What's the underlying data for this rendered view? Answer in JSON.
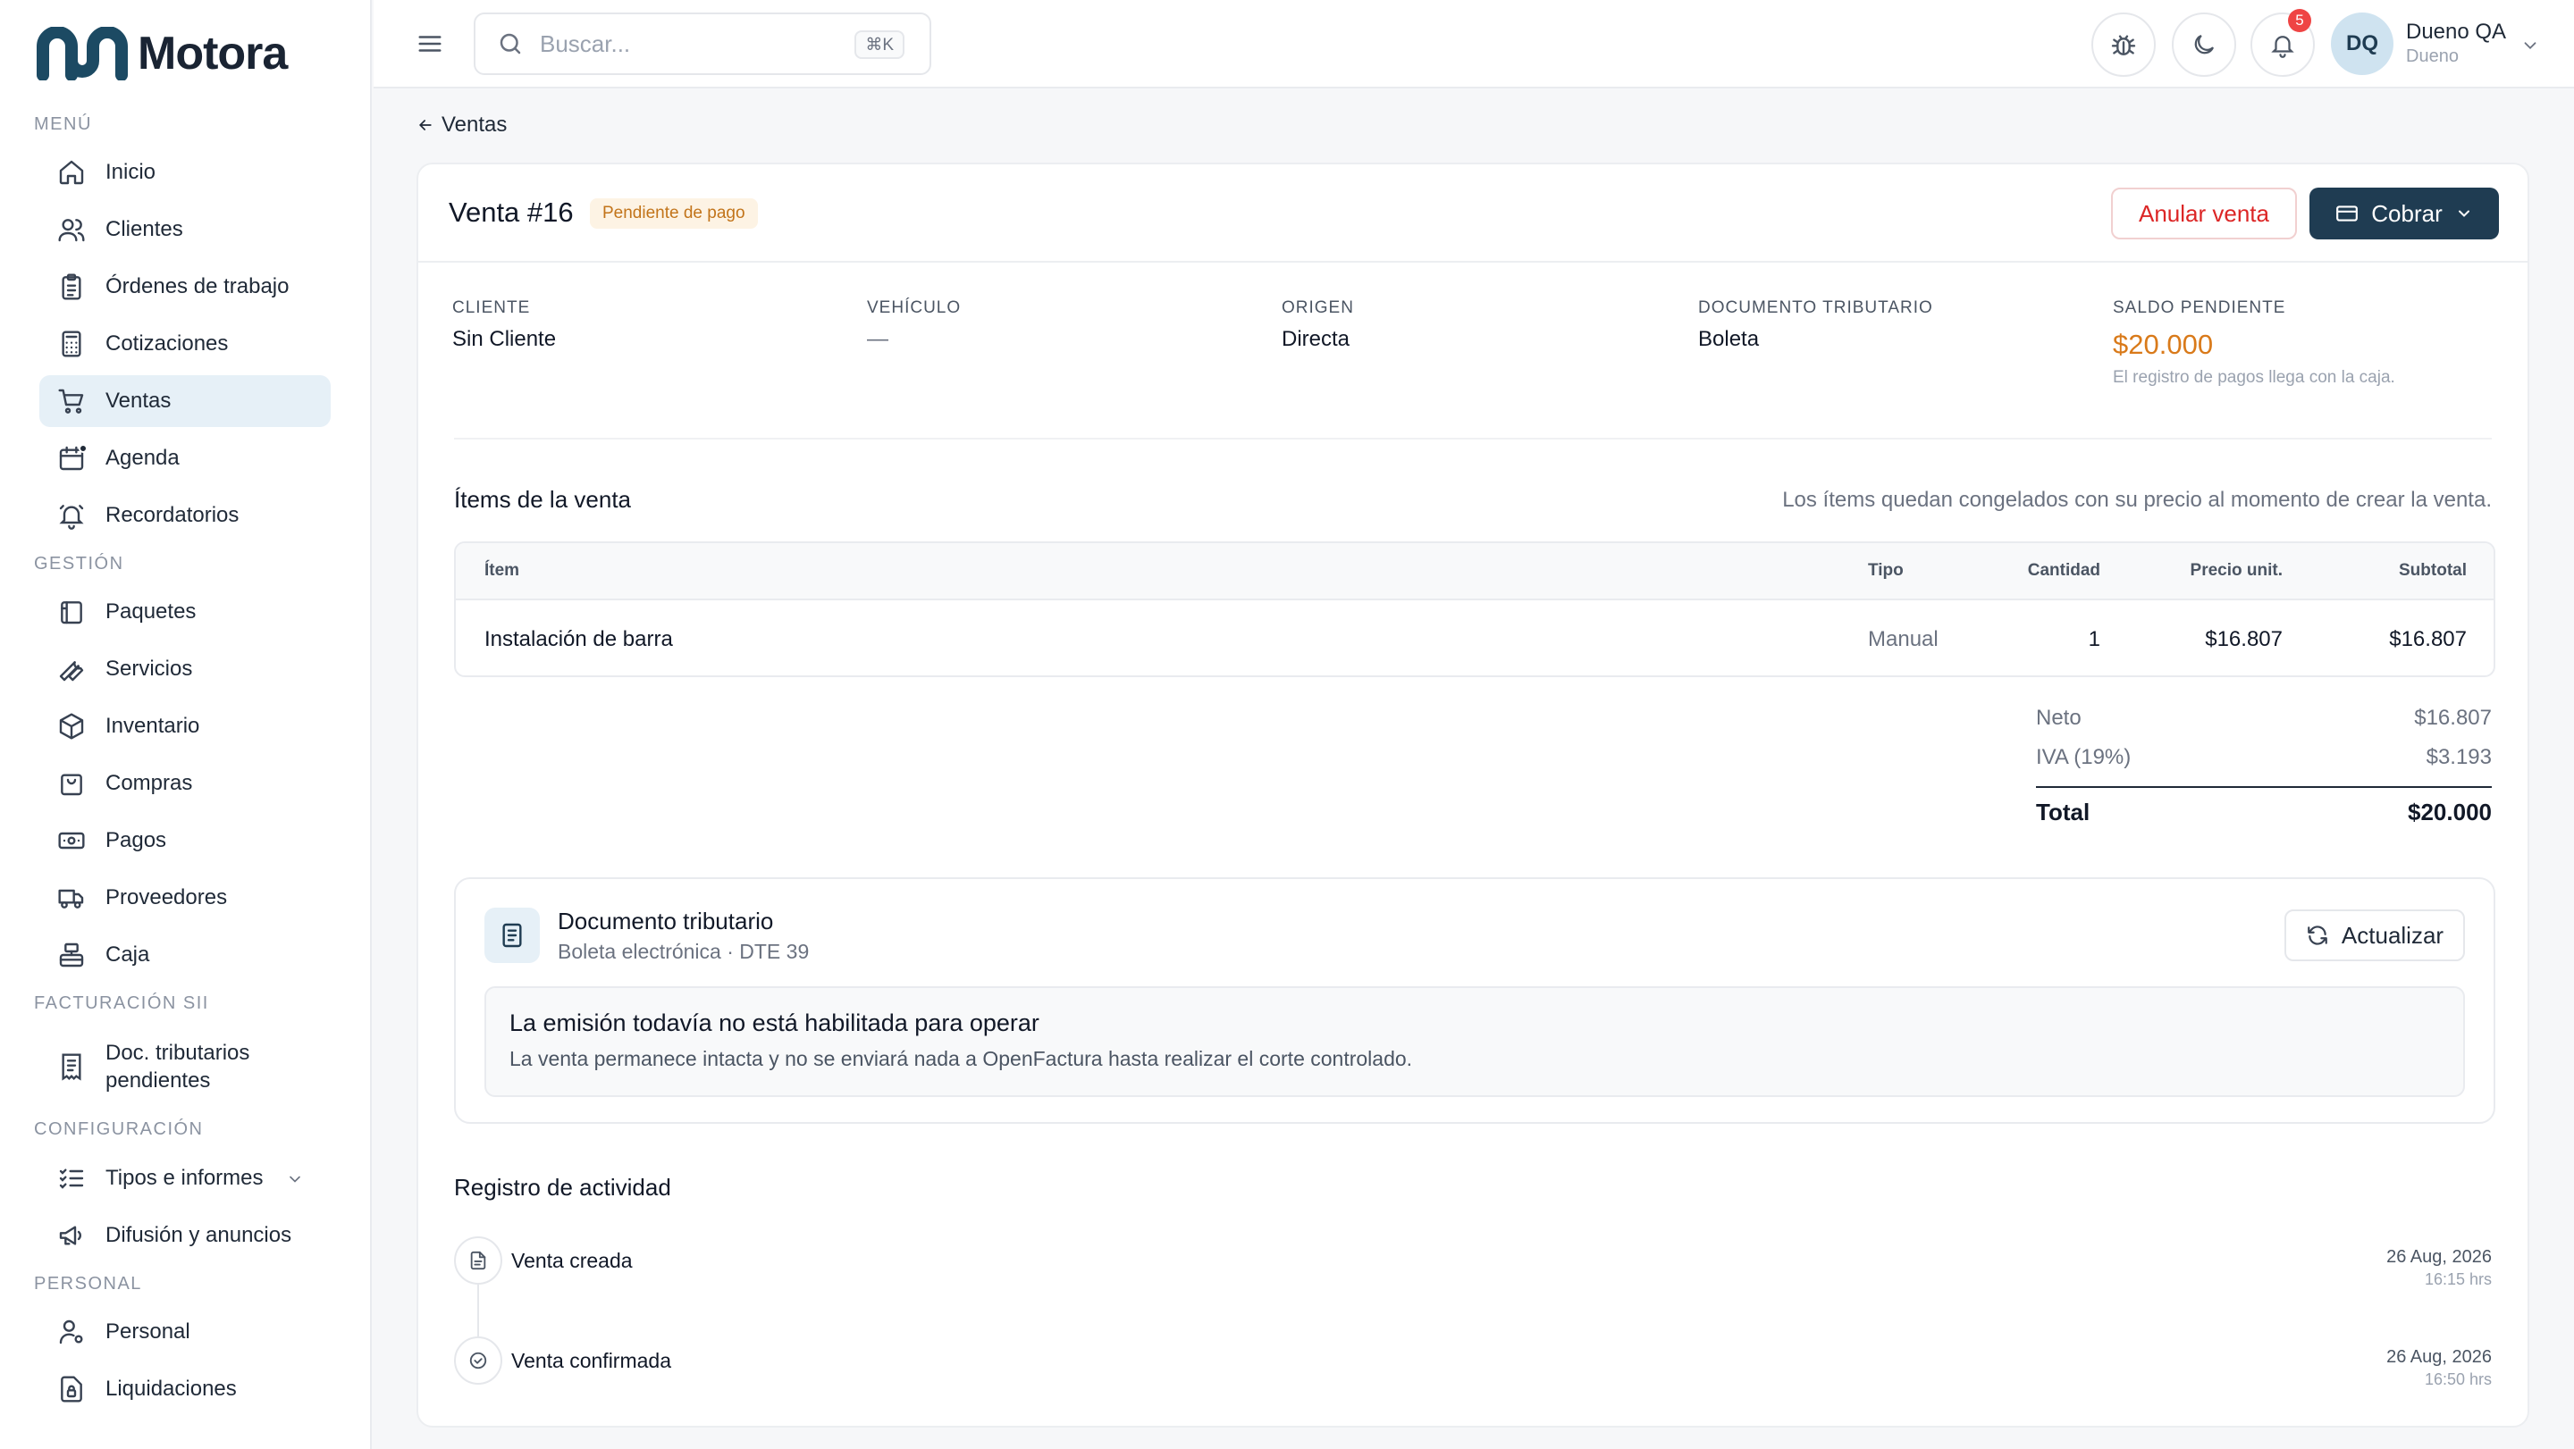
{
  "app": {
    "name": "Motora"
  },
  "sidebar": {
    "sections": [
      {
        "label": "MENÚ"
      },
      {
        "label": "GESTIÓN"
      },
      {
        "label": "FACTURACIÓN SII"
      },
      {
        "label": "CONFIGURACIÓN"
      },
      {
        "label": "PERSONAL"
      }
    ],
    "items": [
      {
        "label": "Inicio",
        "icon": "home-icon"
      },
      {
        "label": "Clientes",
        "icon": "users-icon"
      },
      {
        "label": "Órdenes de trabajo",
        "icon": "clipboard-icon"
      },
      {
        "label": "Cotizaciones",
        "icon": "calculator-icon"
      },
      {
        "label": "Ventas",
        "icon": "cart-icon",
        "active": true
      },
      {
        "label": "Agenda",
        "icon": "calendar-icon"
      },
      {
        "label": "Recordatorios",
        "icon": "bell-ring-icon"
      },
      {
        "label": "Paquetes",
        "icon": "package-icon"
      },
      {
        "label": "Servicios",
        "icon": "wrench-icon"
      },
      {
        "label": "Inventario",
        "icon": "boxes-icon"
      },
      {
        "label": "Compras",
        "icon": "shopping-bag-icon"
      },
      {
        "label": "Pagos",
        "icon": "banknote-icon"
      },
      {
        "label": "Proveedores",
        "icon": "truck-icon"
      },
      {
        "label": "Caja",
        "icon": "register-icon"
      },
      {
        "label": "Doc. tributarios pendientes",
        "icon": "receipt-icon"
      },
      {
        "label": "Tipos e informes",
        "icon": "list-check-icon"
      },
      {
        "label": "Difusión y anuncios",
        "icon": "megaphone-icon"
      },
      {
        "label": "Personal",
        "icon": "user-cog-icon"
      },
      {
        "label": "Liquidaciones",
        "icon": "file-lock-icon"
      }
    ]
  },
  "topbar": {
    "search_placeholder": "Buscar...",
    "search_shortcut": "⌘K",
    "notifications_count": "5",
    "user": {
      "initials": "DQ",
      "name": "Dueno QA",
      "role": "Dueno"
    }
  },
  "breadcrumb": {
    "back_label": "Ventas"
  },
  "sale": {
    "title": "Venta #16",
    "status": "Pendiente de pago",
    "cancel_label": "Anular venta",
    "charge_label": "Cobrar",
    "meta": {
      "cliente_label": "CLIENTE",
      "cliente": "Sin Cliente",
      "vehiculo_label": "VEHÍCULO",
      "vehiculo": "—",
      "origen_label": "ORIGEN",
      "origen": "Directa",
      "doc_label": "DOCUMENTO TRIBUTARIO",
      "doc": "Boleta",
      "saldo_label": "SALDO PENDIENTE",
      "saldo": "$20.000",
      "saldo_note": "El registro de pagos llega con la caja."
    },
    "items_title": "Ítems de la venta",
    "items_note": "Los ítems quedan congelados con su precio al momento de crear la venta.",
    "table": {
      "headers": {
        "item": "Ítem",
        "tipo": "Tipo",
        "cantidad": "Cantidad",
        "precio": "Precio unit.",
        "subtotal": "Subtotal"
      },
      "rows": [
        {
          "item": "Instalación de barra",
          "tipo": "Manual",
          "cantidad": "1",
          "precio": "$16.807",
          "subtotal": "$16.807"
        }
      ]
    },
    "totals": {
      "neto_label": "Neto",
      "neto": "$16.807",
      "iva_label": "IVA (19%)",
      "iva": "$3.193",
      "total_label": "Total",
      "total": "$20.000"
    },
    "tax_doc": {
      "title": "Documento tributario",
      "subtitle": "Boleta electrónica · DTE 39",
      "refresh_label": "Actualizar",
      "warning_title": "La emisión todavía no está habilitada para operar",
      "warning_text": "La venta permanece intacta y no se enviará nada a OpenFactura hasta realizar el corte controlado."
    },
    "activity": {
      "title": "Registro de actividad",
      "events": [
        {
          "label": "Venta creada",
          "date": "26 Aug, 2026",
          "time": "16:15 hrs"
        },
        {
          "label": "Venta confirmada",
          "date": "26 Aug, 2026",
          "time": "16:50 hrs"
        }
      ]
    }
  },
  "colors": {
    "brand": "#1f3c52",
    "accent_orange": "#d97a1a",
    "danger": "#dc2626",
    "active_bg": "#e6f0f7"
  }
}
